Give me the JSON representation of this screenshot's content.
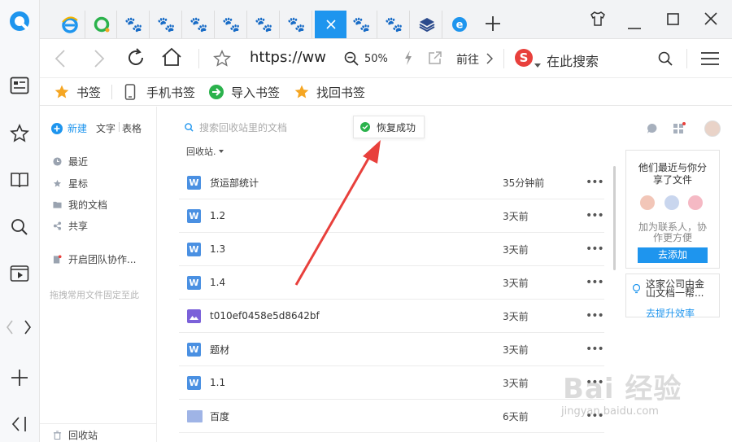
{
  "browser": {
    "address_text": "https://ww",
    "zoom": "50%",
    "forward_label": "前往",
    "search_label": "在此搜索"
  },
  "bookmarks": {
    "items": [
      {
        "label": "书签"
      },
      {
        "label": "手机书签"
      },
      {
        "label": "导入书签"
      },
      {
        "label": "找回书签"
      }
    ]
  },
  "sidebar": {
    "new_label": "新建",
    "type_doc": "文字",
    "type_sheet": "表格",
    "items": [
      {
        "label": "最近"
      },
      {
        "label": "星标"
      },
      {
        "label": "我的文档"
      },
      {
        "label": "共享"
      }
    ],
    "team_label": "开启团队协作...",
    "drag_hint": "拖拽常用文件固定至此",
    "recycle_label": "回收站"
  },
  "main": {
    "search_placeholder": "搜索回收站里的文档",
    "toast": "恢复成功",
    "breadcrumb": "回收站.",
    "files": [
      {
        "name": "货运部统计",
        "time": "35分钟前",
        "type": "doc"
      },
      {
        "name": "1.2",
        "time": "3天前",
        "type": "doc"
      },
      {
        "name": "1.3",
        "time": "3天前",
        "type": "doc"
      },
      {
        "name": "1.4",
        "time": "3天前",
        "type": "doc"
      },
      {
        "name": "t010ef0458e5d8642bf",
        "time": "3天前",
        "type": "image"
      },
      {
        "name": "题材",
        "time": "3天前",
        "type": "doc"
      },
      {
        "name": "1.1",
        "time": "3天前",
        "type": "doc"
      },
      {
        "name": "百度",
        "time": "6天前",
        "type": "folder"
      }
    ]
  },
  "right_panel": {
    "share_title_1": "他们最近与你分",
    "share_title_2": "享了文件",
    "share_desc_1": "加为联系人，协",
    "share_desc_2": "作更方便",
    "add_button": "去添加",
    "tip_line_1": "这家公司由金",
    "tip_line_2": "山文档一帮...",
    "tip_link": "去提升效率"
  },
  "watermark": {
    "brand": "Bai 经验",
    "url": "jingyan.baidu.com"
  },
  "colors": {
    "accent_blue": "#1e95ee",
    "doc_icon": "#4a90e2",
    "image_icon": "#7b61d9",
    "folder_icon": "#9fb4e6",
    "arrow_red": "#e8403c",
    "toast_green": "#2bb24c",
    "star_orange": "#f5a623"
  }
}
